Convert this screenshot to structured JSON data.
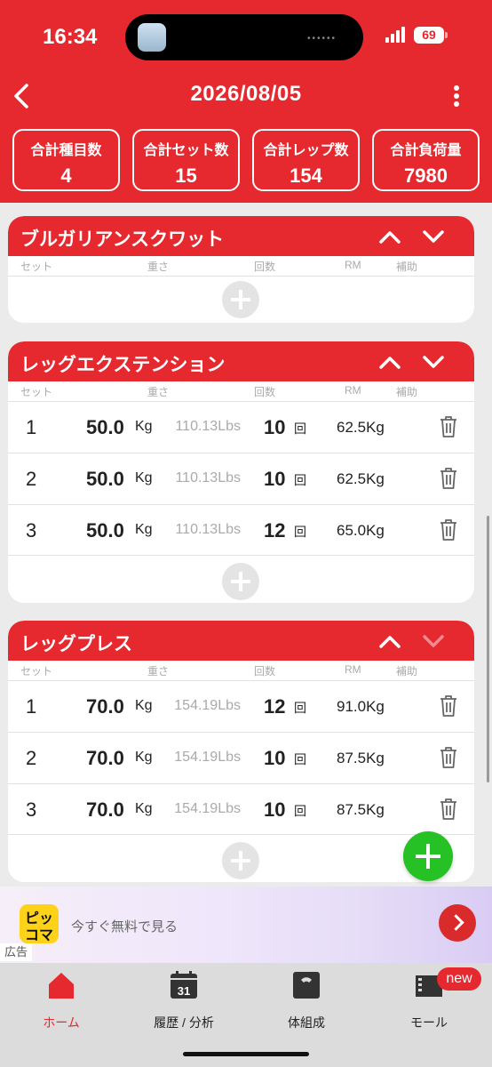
{
  "status": {
    "time": "16:34",
    "battery": "69"
  },
  "header": {
    "date": "2026/08/05"
  },
  "stats": [
    {
      "label": "合計種目数",
      "value": "4"
    },
    {
      "label": "合計セット数",
      "value": "15"
    },
    {
      "label": "合計レップ数",
      "value": "154"
    },
    {
      "label": "合計負荷量",
      "value": "7980"
    }
  ],
  "columns": {
    "set": "セット",
    "weight": "重さ",
    "reps": "回数",
    "rm": "RM",
    "assist": "補助"
  },
  "units": {
    "kg": "Kg",
    "kai": "回"
  },
  "exercises": [
    {
      "name": "ブルガリアンスクワット",
      "rows": []
    },
    {
      "name": "レッグエクステンション",
      "rows": [
        {
          "set": "1",
          "weight": "50.0",
          "lbs": "110.13Lbs",
          "reps": "10",
          "rm": "62.5Kg"
        },
        {
          "set": "2",
          "weight": "50.0",
          "lbs": "110.13Lbs",
          "reps": "10",
          "rm": "62.5Kg"
        },
        {
          "set": "3",
          "weight": "50.0",
          "lbs": "110.13Lbs",
          "reps": "12",
          "rm": "65.0Kg"
        }
      ]
    },
    {
      "name": "レッグプレス",
      "rows": [
        {
          "set": "1",
          "weight": "70.0",
          "lbs": "154.19Lbs",
          "reps": "12",
          "rm": "91.0Kg"
        },
        {
          "set": "2",
          "weight": "70.0",
          "lbs": "154.19Lbs",
          "reps": "10",
          "rm": "87.5Kg"
        },
        {
          "set": "3",
          "weight": "70.0",
          "lbs": "154.19Lbs",
          "reps": "10",
          "rm": "87.5Kg"
        }
      ]
    }
  ],
  "ad": {
    "logo_top": "ピッ",
    "logo_bottom": "コマ",
    "text": "今すぐ無料で見る",
    "tag": "広告"
  },
  "tabs": [
    {
      "label": "ホーム",
      "icon": "home-icon"
    },
    {
      "label": "履歴 / 分析",
      "icon": "calendar-icon",
      "calendar_day": "31"
    },
    {
      "label": "体組成",
      "icon": "scale-icon"
    },
    {
      "label": "モール",
      "icon": "store-icon",
      "badge": "new"
    }
  ],
  "colors": {
    "brand_red": "#e6282f",
    "fab_green": "#25c125"
  }
}
